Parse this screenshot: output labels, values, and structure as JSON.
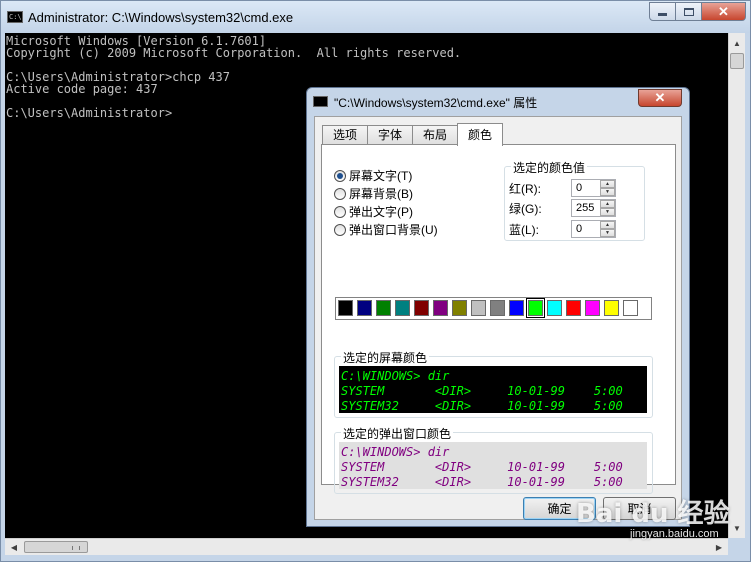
{
  "window": {
    "title": "Administrator: C:\\Windows\\system32\\cmd.exe",
    "close_glyph": "✕"
  },
  "console": {
    "lines": [
      "Microsoft Windows [Version 6.1.7601]",
      "Copyright (c) 2009 Microsoft Corporation.  All rights reserved.",
      "",
      "C:\\Users\\Administrator>chcp 437",
      "Active code page: 437",
      "",
      "C:\\Users\\Administrator>"
    ],
    "text_color": "#c0c0c0",
    "background": "#000000"
  },
  "dialog": {
    "title": "\"C:\\Windows\\system32\\cmd.exe\" 属性",
    "close_glyph": "✕",
    "tabs": [
      {
        "label": "选项",
        "active": false
      },
      {
        "label": "字体",
        "active": false
      },
      {
        "label": "布局",
        "active": false
      },
      {
        "label": "颜色",
        "active": true
      }
    ],
    "targets": [
      {
        "label": "屏幕文字(T)",
        "checked": true
      },
      {
        "label": "屏幕背景(B)",
        "checked": false
      },
      {
        "label": "弹出文字(P)",
        "checked": false
      },
      {
        "label": "弹出窗口背景(U)",
        "checked": false
      }
    ],
    "selected_color_values": {
      "title": "选定的颜色值",
      "red": {
        "label": "红(R):",
        "value": "0"
      },
      "green": {
        "label": "绿(G):",
        "value": "255"
      },
      "blue": {
        "label": "蓝(L):",
        "value": "0"
      }
    },
    "palette": [
      "#000000",
      "#000080",
      "#008000",
      "#008080",
      "#800000",
      "#800080",
      "#808000",
      "#c0c0c0",
      "#808080",
      "#0000ff",
      "#00ff00",
      "#00ffff",
      "#ff0000",
      "#ff00ff",
      "#ffff00",
      "#ffffff"
    ],
    "palette_selected_index": 10,
    "screen_preview": {
      "title": "选定的屏幕颜色",
      "lines": [
        "C:\\WINDOWS> dir",
        "SYSTEM       <DIR>     10-01-99    5:00",
        "SYSTEM32     <DIR>     10-01-99    5:00"
      ],
      "text_color": "#00ff00",
      "background": "#000000"
    },
    "popup_preview": {
      "title": "选定的弹出窗口颜色",
      "lines": [
        "C:\\WINDOWS> dir",
        "SYSTEM       <DIR>     10-01-99    5:00",
        "SYSTEM32     <DIR>     10-01-99    5:00"
      ],
      "text_color": "#800080",
      "background": "#e0e0e0"
    },
    "ok_label": "确定",
    "cancel_label": "取消"
  },
  "watermark": {
    "brand": "Bai du 经验",
    "url": "jingyan.baidu.com"
  }
}
